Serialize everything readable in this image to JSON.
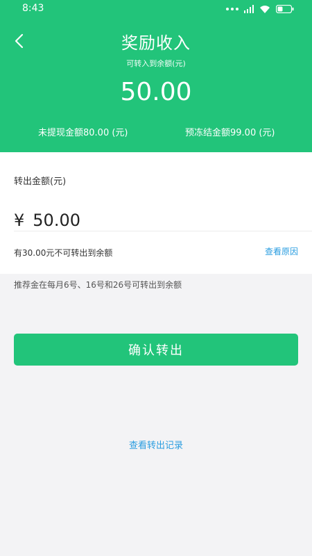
{
  "status_bar": {
    "time": "8:43",
    "icons": [
      "dots-icon",
      "signal-icon",
      "wifi-icon",
      "battery-icon"
    ]
  },
  "header": {
    "title": "奖励收入",
    "subtitle": "可转入到余额(元)",
    "amount": "50.00",
    "unwithdrawn": "未提现金额80.00 (元)",
    "frozen": "预冻结金额99.00 (元)",
    "background_color": "#22c47a"
  },
  "form": {
    "label": "转出金额(元)",
    "currency_symbol": "¥",
    "amount_value": "50.00",
    "note": "有30.00元不可转出到余额",
    "reason_link": "查看原因"
  },
  "hint": "推荐金在每月6号、16号和26号可转出到余额",
  "confirm_button": "确认转出",
  "records_link": "查看转出记录",
  "colors": {
    "accent": "#22c47a",
    "link": "#2a9de0",
    "page_bg": "#f3f3f5"
  }
}
